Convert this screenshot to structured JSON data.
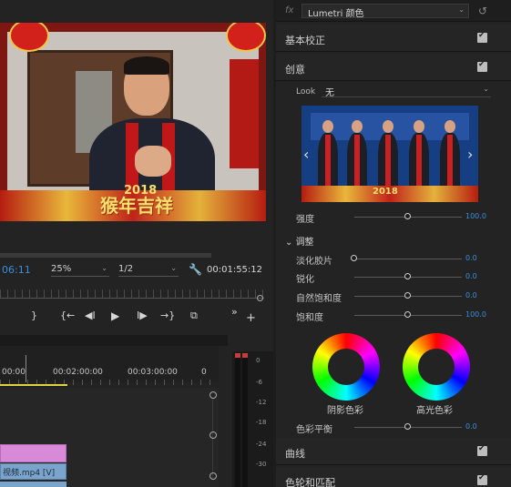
{
  "monitor": {
    "timecode": "06:11",
    "zoom": "25%",
    "resolution": "1/2",
    "duration": "00:01:55:12",
    "video_caption": "猴年吉祥",
    "video_year": "2018"
  },
  "transport": {
    "mark_out": "}",
    "go_in": "{←",
    "step_back": "◀I",
    "play": "▶",
    "step_fwd": "I▶",
    "go_out": "→}",
    "export_frame": "⧉",
    "more": "»",
    "add": "+"
  },
  "timeline": {
    "times": [
      "00:00",
      "00:02:00:00",
      "00:03:00:00",
      "0"
    ],
    "clip_video_label": "视频.mp4 [V]"
  },
  "meter": {
    "db_labels": [
      "0",
      "-6",
      "-12",
      "-18",
      "-24",
      "-30"
    ]
  },
  "lumetri": {
    "fx_label": "fx",
    "effect_name": "Lumetri 颜色",
    "sections": {
      "basic": "基本校正",
      "creative": "创意",
      "curves": "曲线",
      "wheels_match": "色轮和匹配"
    },
    "look": {
      "label": "Look",
      "value": "无"
    },
    "preview_caption": "2018",
    "intensity": {
      "label": "强度",
      "value": "100.0",
      "position": 0.5
    },
    "adjust_label": "调整",
    "adjust_sliders": [
      {
        "label": "淡化胶片",
        "value": "0.0",
        "position": 0.0
      },
      {
        "label": "锐化",
        "value": "0.0",
        "position": 0.5
      },
      {
        "label": "自然饱和度",
        "value": "0.0",
        "position": 0.5
      },
      {
        "label": "饱和度",
        "value": "100.0",
        "position": 0.5
      }
    ],
    "wheels": {
      "shadow_label": "阴影色彩",
      "highlight_label": "高光色彩"
    },
    "color_balance": {
      "label": "色彩平衡",
      "value": "0.0",
      "position": 0.5
    }
  },
  "colors": {
    "accent": "#3b8edc",
    "clip_audio": "#d889d8",
    "clip_video": "#7ba4cc",
    "in_out_bar": "#e1d33b"
  }
}
